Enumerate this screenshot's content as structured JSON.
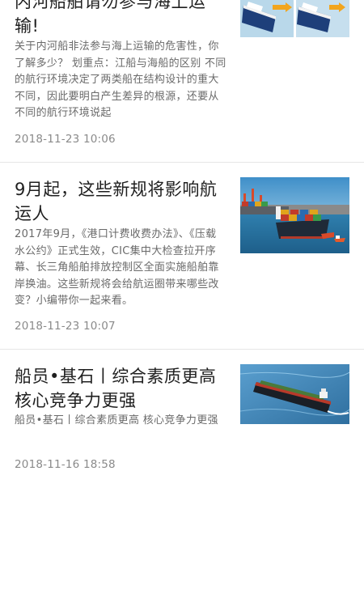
{
  "articles": [
    {
      "title": "内河船舶请勿参与海上运输!",
      "summary": "关于内河船非法参与海上运输的危害性，你了解多少？ 划重点：江船与海船的区别 不同的航行环境决定了两类船在结构设计的重大不同，因此要明白产生差异的根源，还要从不同的航行环境说起",
      "date": "2018-11-23 10:06",
      "image_desc": "two-ships-comparison-image"
    },
    {
      "title": "9月起，这些新规将影响航运人",
      "summary": "2017年9月，《港口计费收费办法》、《压载水公约》正式生效，CIC集中大检查拉开序幕、长三角船舶排放控制区全面实施船舶靠岸换油。这些新规将会给航运圈带来哪些改变？小编带你一起来看。",
      "date": "2018-11-23 10:07",
      "image_desc": "container-ship-port-image"
    },
    {
      "title": "船员•基石丨综合素质更高 核心竞争力更强",
      "summary": "船员•基石丨综合素质更高 核心竞争力更强",
      "date": "2018-11-16 18:58",
      "image_desc": "tanker-at-sea-image"
    }
  ],
  "colors": {
    "title": "#1f1f1f",
    "summary": "#6a6a6a",
    "date": "#8a8a8a",
    "divider": "#e6e6e6"
  }
}
